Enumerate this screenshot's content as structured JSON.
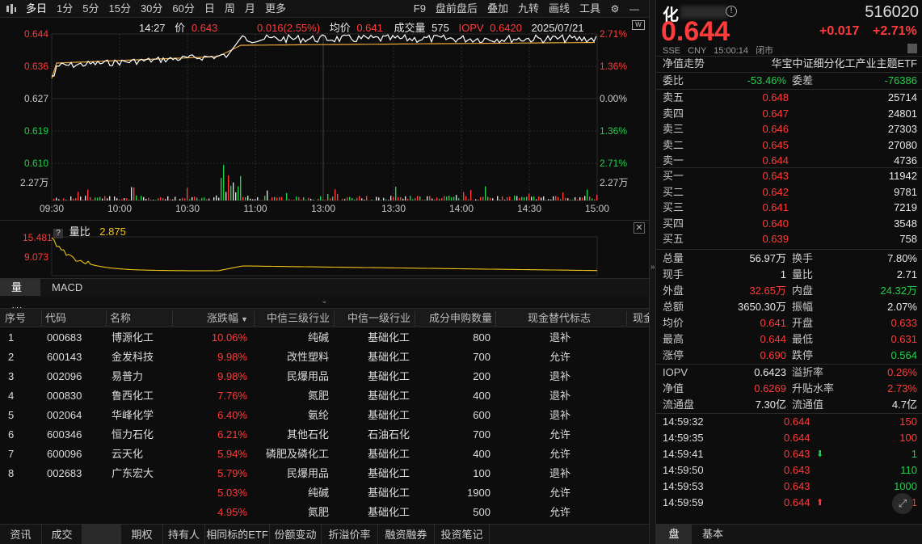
{
  "toolbar": {
    "periods": [
      "多日",
      "1分",
      "5分",
      "15分",
      "30分",
      "60分",
      "日",
      "周",
      "月",
      "更多"
    ],
    "right_items": [
      "F9",
      "盘前盘后",
      "叠加",
      "九转",
      "画线",
      "工具"
    ]
  },
  "chart_header": {
    "time": "14:27",
    "price_label": "价",
    "price": "0.643",
    "change": "0.016(2.55%)",
    "avg_label": "均价",
    "avg": "0.641",
    "volume_label": "成交量",
    "volume": "575",
    "iopv_label": "IOPV",
    "iopv": "0.6420",
    "date": "2025/07/21"
  },
  "chart_axes": {
    "left_prices": [
      "0.644",
      "0.636",
      "0.627",
      "0.619",
      "0.610"
    ],
    "right_pcts": [
      "2.71%",
      "1.36%",
      "0.00%",
      "1.36%",
      "2.71%"
    ],
    "vol_label": "2.27万",
    "times": [
      "09:30",
      "10:00",
      "10:30",
      "11:00",
      "13:00",
      "13:30",
      "14:00",
      "14:30",
      "15:00"
    ]
  },
  "ratio_panel": {
    "question": "?",
    "label": "量比",
    "value": "2.875",
    "y_top": "15.481",
    "y_mid": "9.073"
  },
  "mid_tabs": [
    "量比",
    "MACD"
  ],
  "table": {
    "headers": [
      "序号",
      "代码",
      "名称",
      "涨跌幅",
      "中信三级行业",
      "中信一级行业",
      "成分申购数量",
      "现金替代标志",
      "现金"
    ],
    "rows": [
      {
        "idx": "1",
        "code": "000683",
        "name": "博源化工",
        "pct": "10.06%",
        "ind3": "纯碱",
        "ind1": "基础化工",
        "qty": "800",
        "flag": "退补"
      },
      {
        "idx": "2",
        "code": "600143",
        "name": "金发科技",
        "pct": "9.98%",
        "ind3": "改性塑料",
        "ind1": "基础化工",
        "qty": "700",
        "flag": "允许"
      },
      {
        "idx": "3",
        "code": "002096",
        "name": "易普力",
        "pct": "9.98%",
        "ind3": "民爆用品",
        "ind1": "基础化工",
        "qty": "200",
        "flag": "退补"
      },
      {
        "idx": "4",
        "code": "000830",
        "name": "鲁西化工",
        "pct": "7.76%",
        "ind3": "氮肥",
        "ind1": "基础化工",
        "qty": "400",
        "flag": "退补"
      },
      {
        "idx": "5",
        "code": "002064",
        "name": "华峰化学",
        "pct": "6.40%",
        "ind3": "氨纶",
        "ind1": "基础化工",
        "qty": "600",
        "flag": "退补"
      },
      {
        "idx": "6",
        "code": "600346",
        "name": "恒力石化",
        "pct": "6.21%",
        "ind3": "其他石化",
        "ind1": "石油石化",
        "qty": "700",
        "flag": "允许"
      },
      {
        "idx": "7",
        "code": "600096",
        "name": "云天化",
        "pct": "5.94%",
        "ind3": "磷肥及磷化工",
        "ind1": "基础化工",
        "qty": "400",
        "flag": "允许"
      },
      {
        "idx": "8",
        "code": "002683",
        "name": "广东宏大",
        "pct": "5.79%",
        "ind3": "民爆用品",
        "ind1": "基础化工",
        "qty": "100",
        "flag": "退补"
      },
      {
        "idx": "",
        "code": "",
        "name": "",
        "pct": "5.03%",
        "ind3": "纯碱",
        "ind1": "基础化工",
        "qty": "1900",
        "flag": "允许"
      },
      {
        "idx": "",
        "code": "",
        "name": "",
        "pct": "4.95%",
        "ind3": "氮肥",
        "ind1": "基础化工",
        "qty": "500",
        "flag": "允许"
      }
    ]
  },
  "bottom_tabs": [
    "资讯",
    "成交",
    "",
    "期权",
    "持有人",
    "相同标的ETF",
    "份额变动",
    "折溢价率",
    "融资融券",
    "投资笔记"
  ],
  "quote": {
    "name": "化",
    "code": "516020",
    "price": "0.644",
    "change": "+0.017",
    "change_pct": "+2.71%",
    "exchange": "SSE",
    "currency": "CNY",
    "time": "15:00:14",
    "status": "闭市",
    "nav_label": "净值走势",
    "fund_name": "华宝中证细分化工产业主题ETF",
    "wb_label": "委比",
    "wb_value": "-53.46%",
    "wc_label": "委差",
    "wc_value": "-76386"
  },
  "asks": [
    {
      "label": "卖五",
      "price": "0.648",
      "vol": "25714"
    },
    {
      "label": "卖四",
      "price": "0.647",
      "vol": "24801"
    },
    {
      "label": "卖三",
      "price": "0.646",
      "vol": "27303"
    },
    {
      "label": "卖二",
      "price": "0.645",
      "vol": "27080"
    },
    {
      "label": "卖一",
      "price": "0.644",
      "vol": "4736"
    }
  ],
  "bids": [
    {
      "label": "买一",
      "price": "0.643",
      "vol": "11942"
    },
    {
      "label": "买二",
      "price": "0.642",
      "vol": "9781"
    },
    {
      "label": "买三",
      "price": "0.641",
      "vol": "7219"
    },
    {
      "label": "买四",
      "price": "0.640",
      "vol": "3548"
    },
    {
      "label": "买五",
      "price": "0.639",
      "vol": "758"
    }
  ],
  "stats": [
    {
      "l1": "总量",
      "v1": "56.97万",
      "c1": "white",
      "l2": "换手",
      "v2": "7.80%",
      "c2": "white"
    },
    {
      "l1": "现手",
      "v1": "1",
      "c1": "white",
      "l2": "量比",
      "v2": "2.71",
      "c2": "white"
    },
    {
      "l1": "外盘",
      "v1": "32.65万",
      "c1": "red",
      "l2": "内盘",
      "v2": "24.32万",
      "c2": "green"
    },
    {
      "l1": "总额",
      "v1": "3650.30万",
      "c1": "white",
      "l2": "振幅",
      "v2": "2.07%",
      "c2": "white"
    },
    {
      "l1": "均价",
      "v1": "0.641",
      "c1": "red",
      "l2": "开盘",
      "v2": "0.633",
      "c2": "red"
    },
    {
      "l1": "最高",
      "v1": "0.644",
      "c1": "red",
      "l2": "最低",
      "v2": "0.631",
      "c2": "red"
    },
    {
      "l1": "涨停",
      "v1": "0.690",
      "c1": "red",
      "l2": "跌停",
      "v2": "0.564",
      "c2": "green"
    }
  ],
  "stats2": [
    {
      "l1": "IOPV",
      "v1": "0.6423",
      "c1": "white",
      "l2": "溢折率",
      "v2": "0.26%",
      "c2": "red"
    },
    {
      "l1": "净值",
      "v1": "0.6269",
      "c1": "red",
      "l2": "升贴水率",
      "v2": "2.73%",
      "c2": "red"
    },
    {
      "l1": "流通盘",
      "v1": "7.30亿",
      "c1": "white",
      "l2": "流通值",
      "v2": "4.7亿",
      "c2": "white"
    }
  ],
  "ticks": [
    {
      "time": "14:59:32",
      "price": "0.644",
      "vol": "150",
      "vc": "red",
      "arrow": ""
    },
    {
      "time": "14:59:35",
      "price": "0.644",
      "vol": "100",
      "vc": "red",
      "arrow": ""
    },
    {
      "time": "14:59:41",
      "price": "0.643",
      "vol": "1",
      "vc": "green",
      "arrow": "down"
    },
    {
      "time": "14:59:50",
      "price": "0.643",
      "vol": "110",
      "vc": "green",
      "arrow": ""
    },
    {
      "time": "14:59:53",
      "price": "0.643",
      "vol": "1000",
      "vc": "green",
      "arrow": ""
    },
    {
      "time": "14:59:59",
      "price": "0.644",
      "vol": "1",
      "vc": "red",
      "arrow": "up"
    }
  ],
  "right_tabs": [
    "盘",
    "基本"
  ]
}
